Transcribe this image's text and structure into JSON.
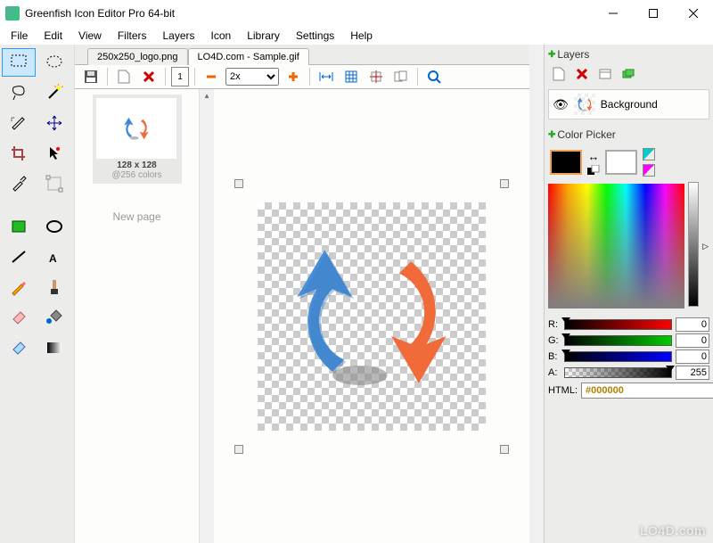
{
  "window": {
    "title": "Greenfish Icon Editor Pro 64-bit"
  },
  "menu": [
    "File",
    "Edit",
    "View",
    "Filters",
    "Layers",
    "Icon",
    "Library",
    "Settings",
    "Help"
  ],
  "tabs": [
    {
      "label": "250x250_logo.png",
      "active": false
    },
    {
      "label": "LO4D.com - Sample.gif",
      "active": true
    }
  ],
  "toolbar": {
    "frame_number": "1",
    "zoom": "2x"
  },
  "page": {
    "dimensions": "128 x 128",
    "colors": "@256 colors",
    "new_page": "New page"
  },
  "panels": {
    "layers_title": "Layers",
    "layer_name": "Background",
    "color_picker_title": "Color Picker"
  },
  "color": {
    "r": "0",
    "g": "0",
    "b": "0",
    "a": "255",
    "html_label": "HTML:",
    "html_value": "#000000",
    "labels": {
      "r": "R:",
      "g": "G:",
      "b": "B:",
      "a": "A:"
    }
  },
  "watermark": "LO4D.com"
}
